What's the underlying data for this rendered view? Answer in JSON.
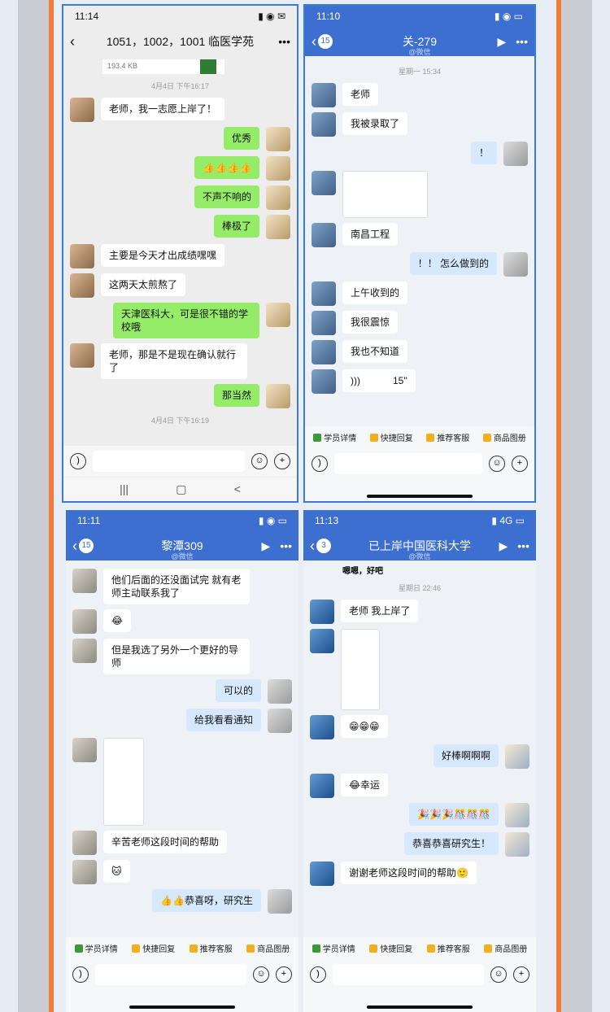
{
  "p1": {
    "status": {
      "time": "11:14"
    },
    "title": "1051，1002，1001 临医学苑",
    "file_size": "193.4 KB",
    "time1": "4月4日 下午16:17",
    "time2": "4月4日 下午16:19",
    "messages": [
      {
        "side": "l",
        "text": "老师，我一志愿上岸了！"
      },
      {
        "side": "r",
        "text": "优秀"
      },
      {
        "side": "r",
        "text": "👍👍👍👍"
      },
      {
        "side": "r",
        "text": "不声不响的"
      },
      {
        "side": "r",
        "text": "棒极了"
      },
      {
        "side": "l",
        "text": "主要是今天才出成绩嘿嘿"
      },
      {
        "side": "l",
        "text": "这两天太煎熬了"
      },
      {
        "side": "r",
        "text": "天津医科大，可是很不错的学校哦"
      },
      {
        "side": "l",
        "text": "老师，那是不是现在确认就行了"
      },
      {
        "side": "r",
        "text": "那当然"
      }
    ],
    "nav_icons": [
      "|||",
      "▢",
      "<"
    ]
  },
  "p2": {
    "status": {
      "time": "11:10"
    },
    "badge": "15",
    "title": "关-279",
    "subtitle": "@微信",
    "time1": "星期一 15:34",
    "messages": [
      {
        "side": "l",
        "text": "老师"
      },
      {
        "side": "l",
        "text": "我被录取了"
      },
      {
        "side": "r",
        "text": "！"
      },
      {
        "side": "l",
        "text": "南昌工程"
      },
      {
        "side": "r",
        "text": "！！ 怎么做到的"
      },
      {
        "side": "l",
        "text": "上午收到的"
      },
      {
        "side": "l",
        "text": "我很震惊"
      },
      {
        "side": "l",
        "text": "我也不知道"
      }
    ],
    "voice_length": "15''"
  },
  "p3": {
    "status": {
      "time": "11:11"
    },
    "badge": "15",
    "title": "黎潭309",
    "subtitle": "@微信",
    "messages": [
      {
        "side": "l",
        "text": "他们后面的还没面试完 就有老师主动联系我了"
      },
      {
        "side": "l",
        "text": "😂"
      },
      {
        "side": "l",
        "text": "但是我选了另外一个更好的导师"
      },
      {
        "side": "r",
        "text": "可以的"
      },
      {
        "side": "r",
        "text": "给我看看通知"
      },
      {
        "side": "l",
        "text": "辛苦老师这段时间的帮助"
      },
      {
        "side": "l",
        "text": "🐱"
      },
      {
        "side": "r",
        "text": "👍👍恭喜呀，研究生"
      }
    ]
  },
  "p4": {
    "status": {
      "time": "11:13",
      "net": "4G"
    },
    "badge": "3",
    "title": "已上岸中国医科大学",
    "subtitle": "@微信",
    "top_text": "嗯嗯，好吧",
    "time1": "星期日 22:46",
    "messages": [
      {
        "side": "l",
        "text": "老师 我上岸了"
      },
      {
        "side": "l",
        "text": "😁😁😁"
      },
      {
        "side": "r",
        "text": "好棒啊啊啊"
      },
      {
        "side": "l",
        "text": "😂幸运"
      },
      {
        "side": "r",
        "text": "🎉🎉🎉🎊🎊🎊"
      },
      {
        "side": "r",
        "text": "恭喜恭喜研究生！"
      },
      {
        "side": "l",
        "text": "谢谢老师这段时间的帮助🙂"
      }
    ]
  },
  "toolbar": [
    "学员详情",
    "快捷回复",
    "推荐客服",
    "商品图册"
  ]
}
